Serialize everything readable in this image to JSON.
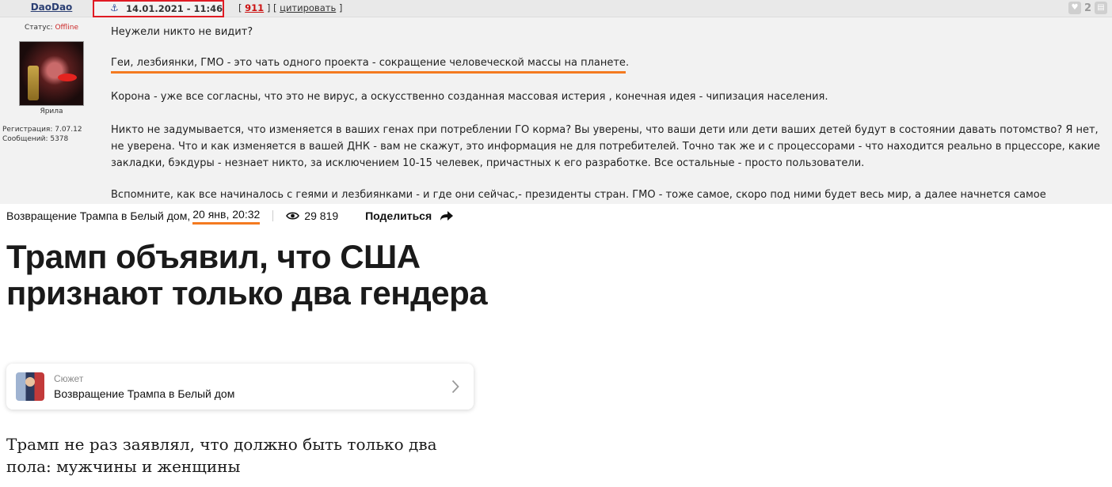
{
  "forum": {
    "author": "DaoDao",
    "post_date": "14.01.2021 - 11:46",
    "header_link_open": "[",
    "post_number": "911",
    "header_link_mid": "] [",
    "quote_label": "цитировать",
    "header_link_close": "]",
    "like_count": "2",
    "status_label": "Статус:",
    "status_value": "Offline",
    "avatar_caption": "Ярила",
    "registration": "Регистрация: 7.07.12",
    "messages": "Сообщений: 5378",
    "paragraphs": {
      "p1": "Неужели никто не видит?",
      "p2": "Геи, лезбиянки, ГМО - это чать одного проекта - сокращение человеческой массы на планете",
      "p2_end": ".",
      "p3": "Корона - уже все согласны, что это не вирус, а оскусственно созданная массовая истерия , конечная идея - чипизация населения.",
      "p4": "Никто не задумывается, что изменяется в ваших генах при потреблении ГО корма? Вы уверены, что ваши дети или дети ваших детей будут в состоянии давать потомство? Я нет, не уверена. Что и как изменяется в вашей ДНК - вам не скажут, это информация не для потребителей. Точно так же и с процессорами - что находится реально в прцессоре, какие закладки, бэкдуры - незнает никто, за исключением 10-15 челевек, причастных к его разработке. Все остальные - просто пользователи.",
      "p5": "Вспомните, как все начиналось с геями и лезбиянками - и где они сейчас,- президенты стран. ГМО - тоже самое, скоро под ними будет весь мир, а далее начнется самое интересное."
    }
  },
  "news": {
    "topic": "Возвращение Трампа в Белый дом,",
    "time": "20 янв, 20:32",
    "views": "29 819",
    "share_label": "Поделиться",
    "headline": "Трамп объявил, что США признают только два гендера",
    "story_kicker": "Сюжет",
    "story_title": "Возвращение Трампа в Белый дом",
    "subhead": "Трамп не раз заявлял, что должно быть только два пола: мужчины и женщины"
  },
  "colors": {
    "highlight_box": "#e01b24",
    "underline": "#f47a20",
    "post_number": "#cc1111"
  },
  "icons": [
    "anchor-icon",
    "like-icon",
    "print-icon",
    "eye-icon",
    "share-icon",
    "chevron-right-icon"
  ]
}
